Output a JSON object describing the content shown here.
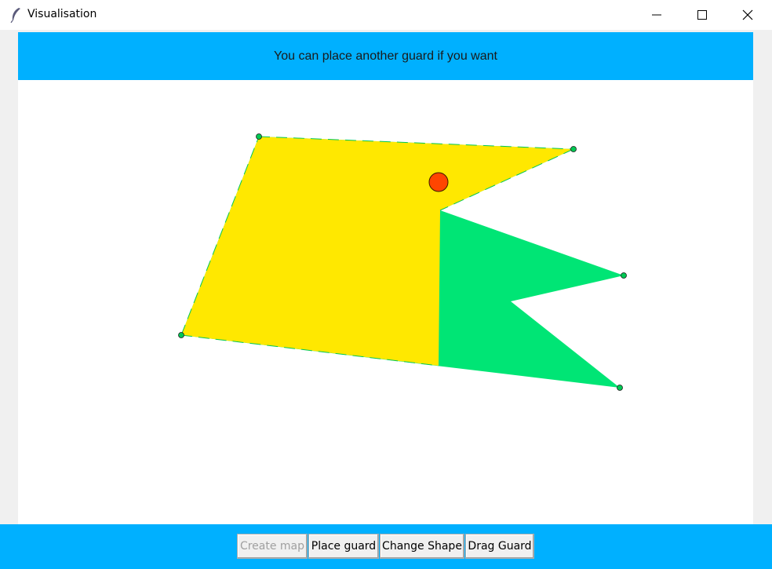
{
  "window": {
    "title": "Visualisation",
    "icon": "feather-icon"
  },
  "banner": {
    "message": "You can place another guard if you want",
    "color": "#00b0ff"
  },
  "colors": {
    "visible_region": "#ffe800",
    "polygon_fill": "#00e575",
    "guard": "#ff4500",
    "vertex": "#00c853"
  },
  "toolbar": {
    "buttons": [
      {
        "label": "Create map",
        "enabled": false
      },
      {
        "label": "Place guard",
        "enabled": true
      },
      {
        "label": "Change Shape",
        "enabled": true
      },
      {
        "label": "Drag Guard",
        "enabled": true
      }
    ]
  }
}
